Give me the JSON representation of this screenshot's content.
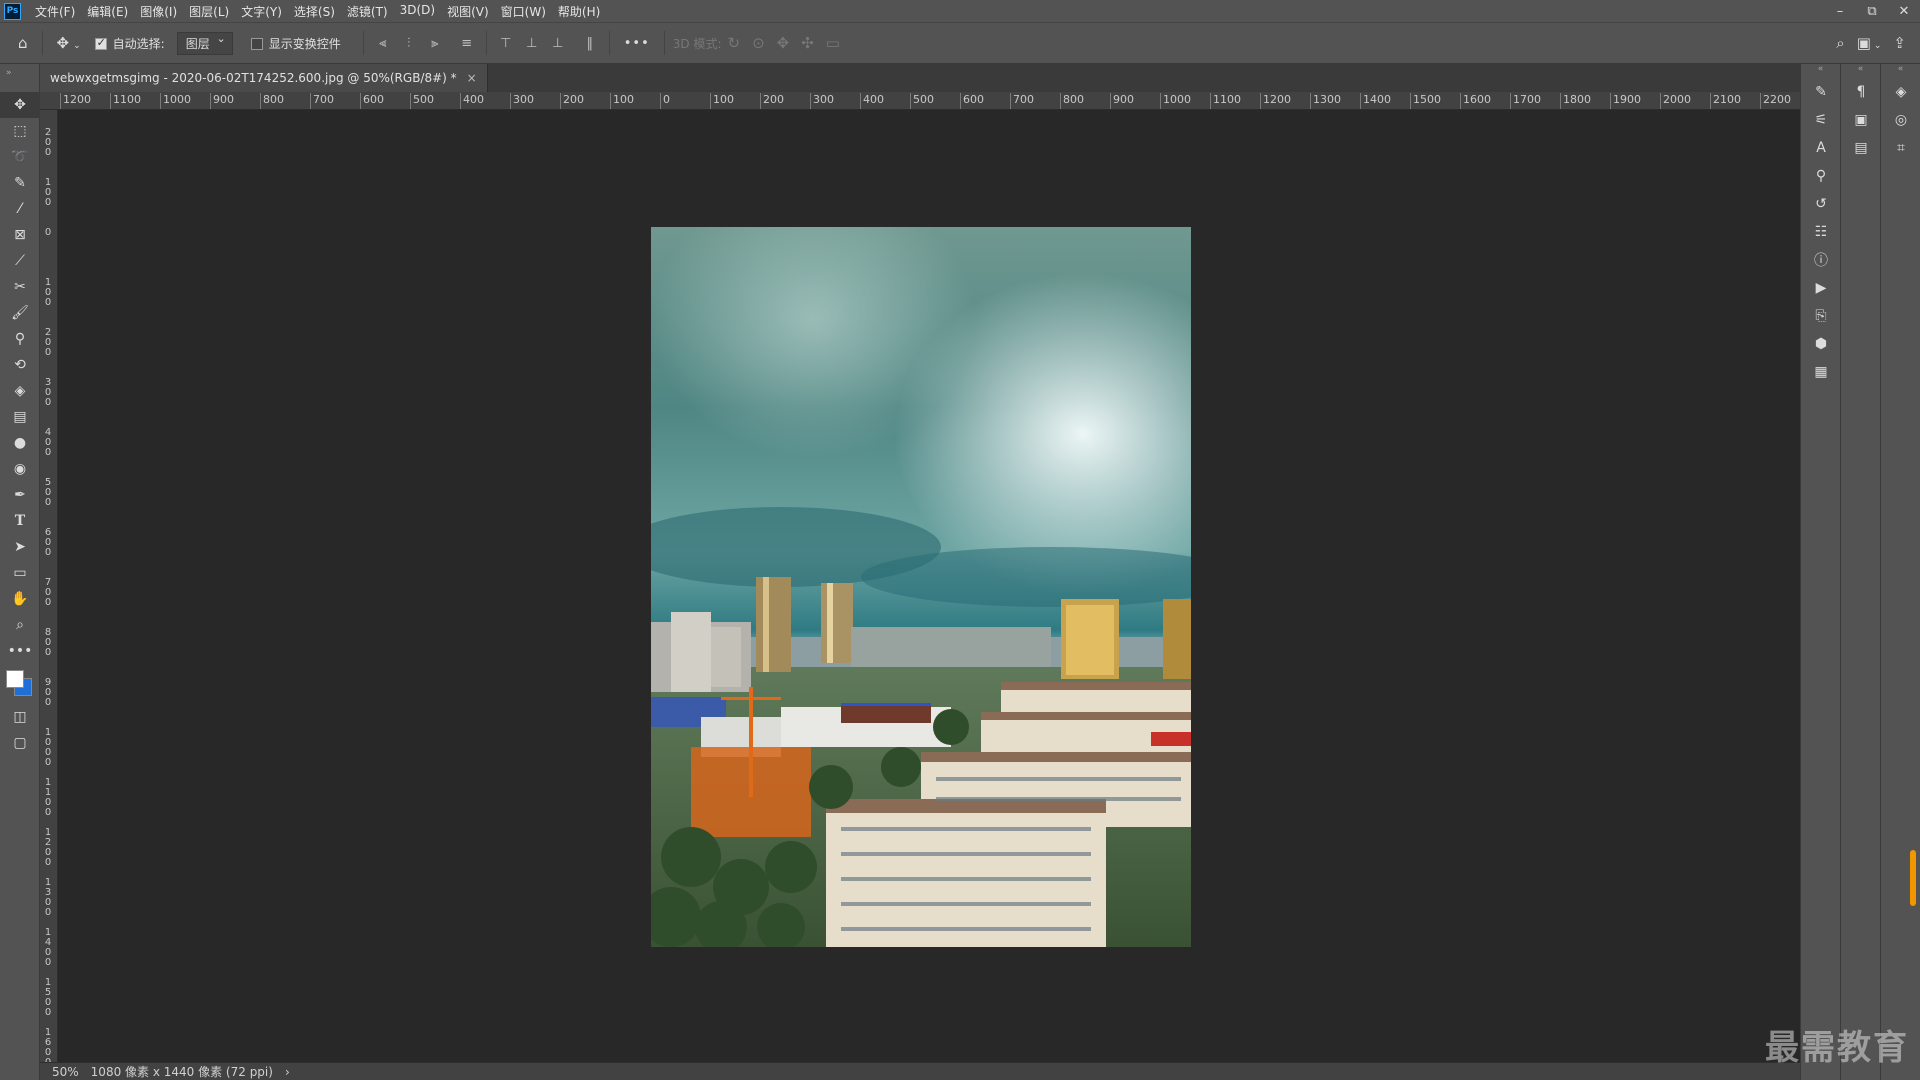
{
  "app": {
    "logo": "Ps"
  },
  "menu": [
    "文件(F)",
    "编辑(E)",
    "图像(I)",
    "图层(L)",
    "文字(Y)",
    "选择(S)",
    "滤镜(T)",
    "3D(D)",
    "视图(V)",
    "窗口(W)",
    "帮助(H)"
  ],
  "window_controls": {
    "minimize": "–",
    "restore": "⧉",
    "close": "✕"
  },
  "options": {
    "auto_select_label": "自动选择:",
    "auto_select_checked": true,
    "auto_select_value": "图层",
    "show_transform_label": "显示变换控件",
    "show_transform_checked": false,
    "more": "•••",
    "mode_3d_label": "3D 模式:"
  },
  "document": {
    "tab_title": "webwxgetmsgimg - 2020-06-02T174252.600.jpg @ 50%(RGB/8#) *",
    "close": "×"
  },
  "ruler_top_labels": [
    "1200",
    "1100",
    "1000",
    "900",
    "800",
    "700",
    "600",
    "500",
    "400",
    "300",
    "200",
    "100",
    "0",
    "100",
    "200",
    "300",
    "400",
    "500",
    "600",
    "700",
    "800",
    "900",
    "1000",
    "1100",
    "1200",
    "1300",
    "1400",
    "1500",
    "1600",
    "1700",
    "1800",
    "1900",
    "2000",
    "2100",
    "2200"
  ],
  "ruler_left_labels": [
    "2\n0\n0",
    "1\n0\n0",
    "0",
    "1\n0\n0",
    "2\n0\n0",
    "3\n0\n0",
    "4\n0\n0",
    "5\n0\n0",
    "6\n0\n0",
    "7\n0\n0",
    "8\n0\n0",
    "9\n0\n0",
    "1\n0\n0\n0",
    "1\n1\n0\n0",
    "1\n2\n0\n0",
    "1\n3\n0\n0",
    "1\n4\n0\n0",
    "1\n5\n0\n0",
    "1\n6\n0\n0"
  ],
  "status": {
    "zoom": "50%",
    "info": "1080 像素 x 1440 像素 (72 ppi)",
    "arrow": "›"
  },
  "colors": {
    "foreground": "#ffffff",
    "background": "#1f6fd6",
    "accent_scroll": "#f29600"
  },
  "tools": [
    "move-icon",
    "marquee-icon",
    "lasso-icon",
    "quick-select-icon",
    "magic-wand-icon",
    "frame-icon",
    "eyedropper-icon",
    "crop-icon",
    "brush-icon",
    "stamp-icon",
    "history-brush-icon",
    "eraser-icon",
    "gradient-icon",
    "blur-icon",
    "sponge-icon",
    "pen-icon",
    "type-icon",
    "path-select-icon",
    "rectangle-icon",
    "hand-icon",
    "zoom-icon",
    "more-tools-icon"
  ],
  "watermark": "最需教育"
}
